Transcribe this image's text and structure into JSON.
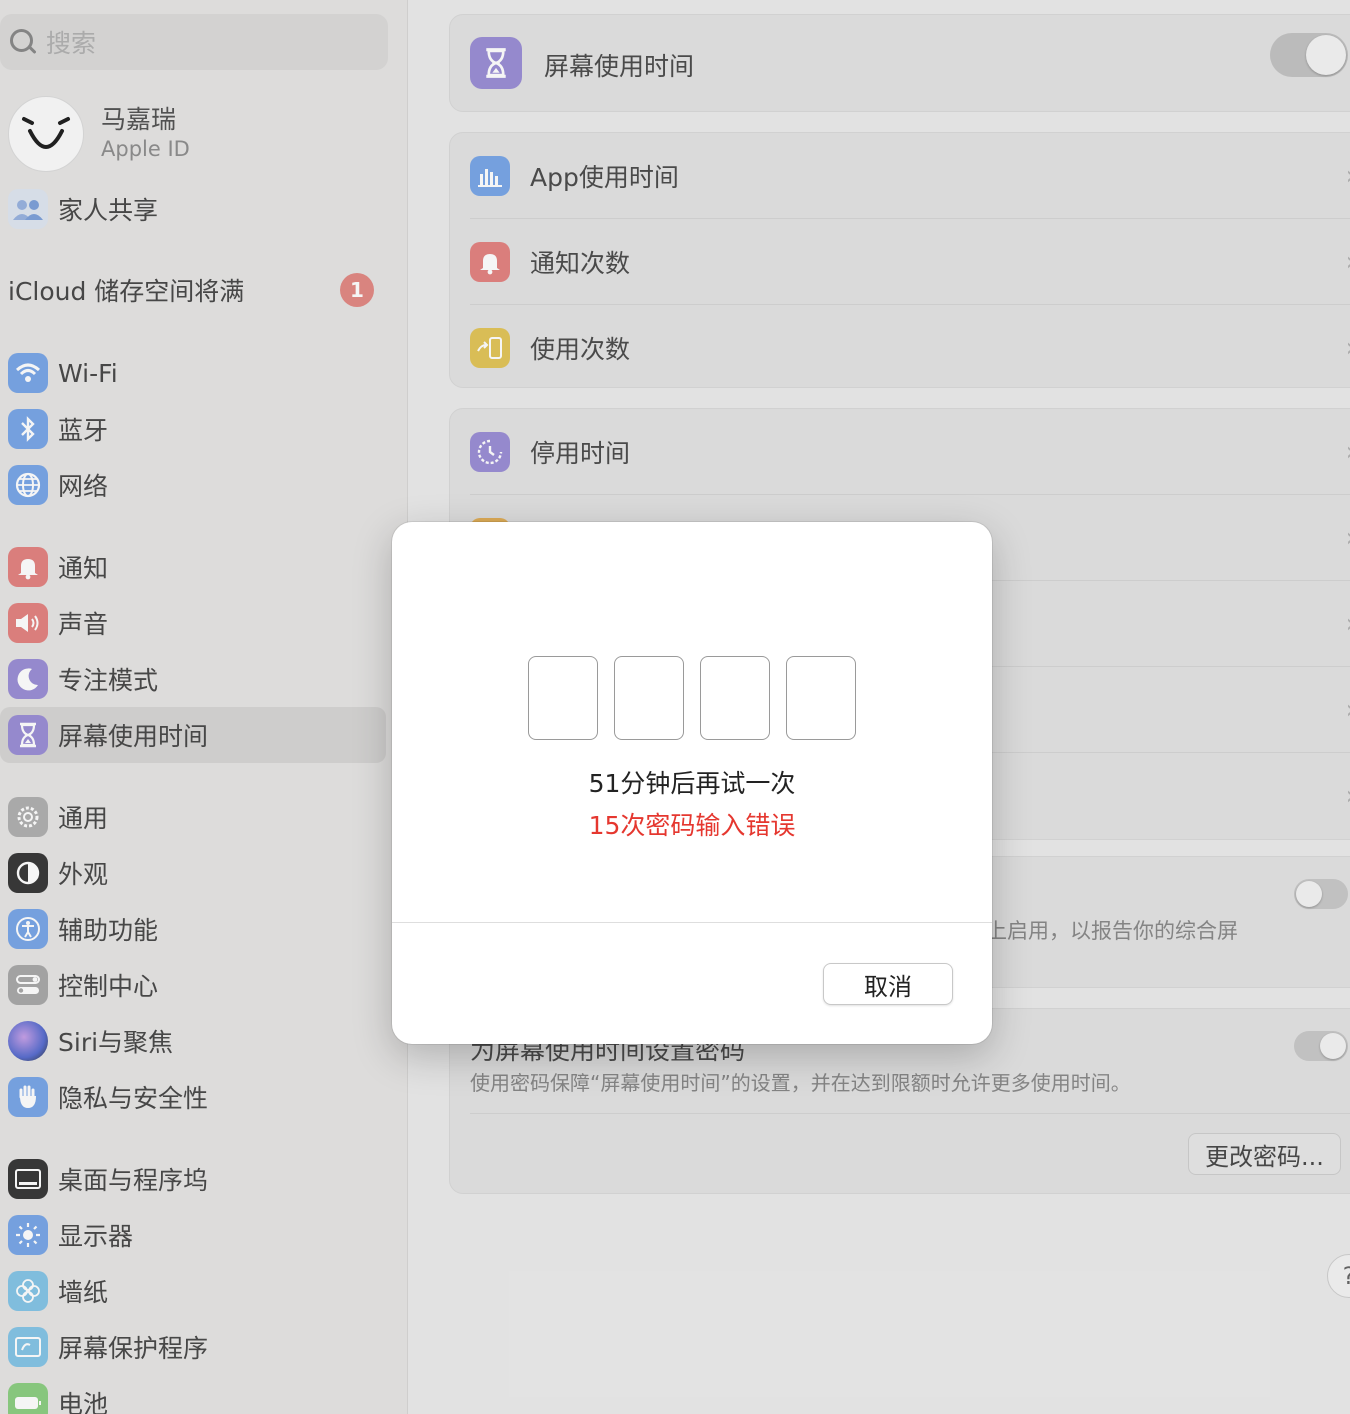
{
  "search": {
    "placeholder": "搜索"
  },
  "profile": {
    "name": "马嘉瑞",
    "subtitle": "Apple ID"
  },
  "family": {
    "label": "家人共享"
  },
  "icloud": {
    "label": "iCloud 储存空间将满",
    "badge": "1"
  },
  "sidebar": {
    "groups": [
      [
        {
          "label": "Wi-Fi",
          "icon": "wifi-icon",
          "color": "#7aa7e8"
        },
        {
          "label": "蓝牙",
          "icon": "bluetooth-icon",
          "color": "#7aa7e8"
        },
        {
          "label": "网络",
          "icon": "globe-icon",
          "color": "#7aa7e8"
        }
      ],
      [
        {
          "label": "通知",
          "icon": "bell-icon",
          "color": "#e38482"
        },
        {
          "label": "声音",
          "icon": "speaker-icon",
          "color": "#e38482"
        },
        {
          "label": "专注模式",
          "icon": "moon-icon",
          "color": "#9c8fd6"
        },
        {
          "label": "屏幕使用时间",
          "icon": "hourglass-icon",
          "color": "#9c8fd6",
          "selected": true
        }
      ],
      [
        {
          "label": "通用",
          "icon": "gear-icon",
          "color": "#a9a9a9"
        },
        {
          "label": "外观",
          "icon": "appearance-icon",
          "color": "#3a3a3a"
        },
        {
          "label": "辅助功能",
          "icon": "accessibility-icon",
          "color": "#7aa7e8"
        },
        {
          "label": "控制中心",
          "icon": "control-center-icon",
          "color": "#a9a9a9"
        },
        {
          "label": "Siri与聚焦",
          "icon": "siri-icon",
          "color": "#8f7fd0"
        },
        {
          "label": "隐私与安全性",
          "icon": "hand-icon",
          "color": "#7aa7e8"
        }
      ],
      [
        {
          "label": "桌面与程序坞",
          "icon": "dock-icon",
          "color": "#3a3a3a"
        },
        {
          "label": "显示器",
          "icon": "sun-icon",
          "color": "#7aa7e8"
        },
        {
          "label": "墙纸",
          "icon": "flower-icon",
          "color": "#86c5e6"
        },
        {
          "label": "屏幕保护程序",
          "icon": "screensaver-icon",
          "color": "#86c5e6"
        },
        {
          "label": "电池",
          "icon": "battery-icon",
          "color": "#8dcf83"
        }
      ]
    ]
  },
  "main": {
    "header": {
      "label": "屏幕使用时间"
    },
    "usage_rows": [
      {
        "label": "App使用时间",
        "icon": "bar-chart-icon",
        "color": "#7aa7e8"
      },
      {
        "label": "通知次数",
        "icon": "bell-icon",
        "color": "#e38482"
      },
      {
        "label": "使用次数",
        "icon": "pickup-icon",
        "color": "#e2c55a"
      }
    ],
    "limit_rows": [
      {
        "label": "停用时间",
        "icon": "downtime-icon",
        "color": "#9c8fd6"
      }
    ],
    "share_desc_fragment": "上启用，以报告你的综合屏",
    "passcode_title": "为屏幕使用时间设置密码",
    "passcode_desc": "使用密码保障“屏幕使用时间”的设置，并在达到限额时允许更多使用时间。",
    "change_passcode": "更改密码...",
    "help": "?"
  },
  "modal": {
    "retry_message": "51分钟后再试一次",
    "error_message": "15次密码输入错误",
    "cancel_label": "取消",
    "error_color": "#e5372f"
  }
}
